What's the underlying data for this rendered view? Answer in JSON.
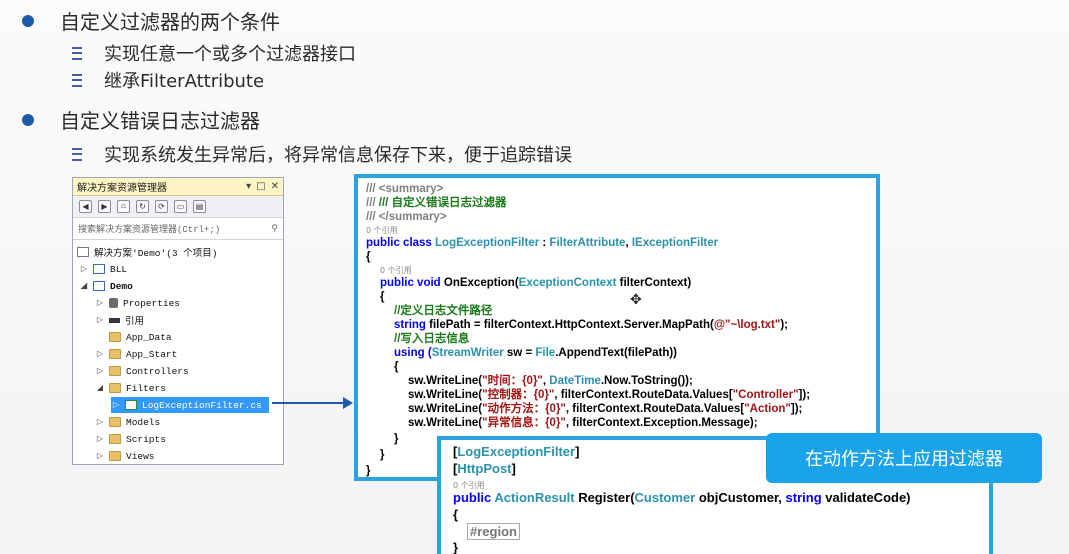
{
  "bullets": {
    "b1": "自定义过滤器的两个条件",
    "b1_sub1": "实现任意一个或多个过滤器接口",
    "b1_sub2": "继承FilterAttribute",
    "b2": "自定义错误日志过滤器",
    "b2_sub1": "实现系统发生异常后，将异常信息保存下来，便于追踪错误"
  },
  "solution_explorer": {
    "title": "解决方案资源管理器",
    "search_placeholder": "搜索解决方案资源管理器(Ctrl+;)",
    "items": [
      {
        "label": "解决方案'Demo'(3 个项目)"
      },
      {
        "label": "BLL"
      },
      {
        "label": "Demo"
      },
      {
        "label": "Properties"
      },
      {
        "label": "引用"
      },
      {
        "label": "App_Data"
      },
      {
        "label": "App_Start"
      },
      {
        "label": "Controllers"
      },
      {
        "label": "Filters"
      },
      {
        "label": "LogExceptionFilter.cs"
      },
      {
        "label": "Models"
      },
      {
        "label": "Scripts"
      },
      {
        "label": "Views"
      }
    ]
  },
  "code1": {
    "l1": "/// <summary>",
    "l2": "/// 自定义错误日志过滤器",
    "l3": "/// </summary>",
    "ref": "0 个引用",
    "l4a": "public class ",
    "l4b": "LogExceptionFilter",
    "l4c": " : ",
    "l4d": "FilterAttribute",
    "l4e": ", ",
    "l4f": "IExceptionFilter",
    "l5": "{",
    "l6a": "public void ",
    "l6b": "OnException(",
    "l6c": "ExceptionContext",
    "l6d": " filterContext)",
    "l7": "{",
    "l8": "//定义日志文件路径",
    "l9a": "string ",
    "l9b": "filePath = filterContext.HttpContext.Server.MapPath(",
    "l9c": "@\"~\\log.txt\"",
    "l9d": ");",
    "l10": "//写入日志信息",
    "l11a": "using (",
    "l11b": "StreamWriter",
    "l11c": " sw = ",
    "l11d": "File",
    "l11e": ".AppendText(filePath))",
    "l12": "{",
    "l13a": "sw.WriteLine(",
    "l13b": "\"时间：{0}\"",
    "l13c": ", ",
    "l13d": "DateTime",
    "l13e": ".Now.ToString());",
    "l14a": "sw.WriteLine(",
    "l14b": "\"控制器：{0}\"",
    "l14c": ", filterContext.RouteData.Values[",
    "l14d": "\"Controller\"",
    "l14e": "]);",
    "l15a": "sw.WriteLine(",
    "l15b": "\"动作方法：{0}\"",
    "l15c": ", filterContext.RouteData.Values[",
    "l15d": "\"Action\"",
    "l15e": "]);",
    "l16a": "sw.WriteLine(",
    "l16b": "\"异常信息：{0}\"",
    "l16c": ", filterContext.Exception.Message);",
    "l17": "}",
    "l18": "}",
    "l19": "}"
  },
  "code2": {
    "l1a": "[",
    "l1b": "LogExceptionFilter",
    "l1c": "]",
    "l2a": "[",
    "l2b": "HttpPost",
    "l2c": "]",
    "ref": "0 个引用",
    "l3a": "public ",
    "l3b": "ActionResult",
    "l3c": " Register(",
    "l3d": "Customer",
    "l3e": " objCustomer, ",
    "l3f": "string",
    "l3g": " validateCode)",
    "l4": "{",
    "l5": "#region",
    "l6": "}"
  },
  "callout": "在动作方法上应用过滤器"
}
